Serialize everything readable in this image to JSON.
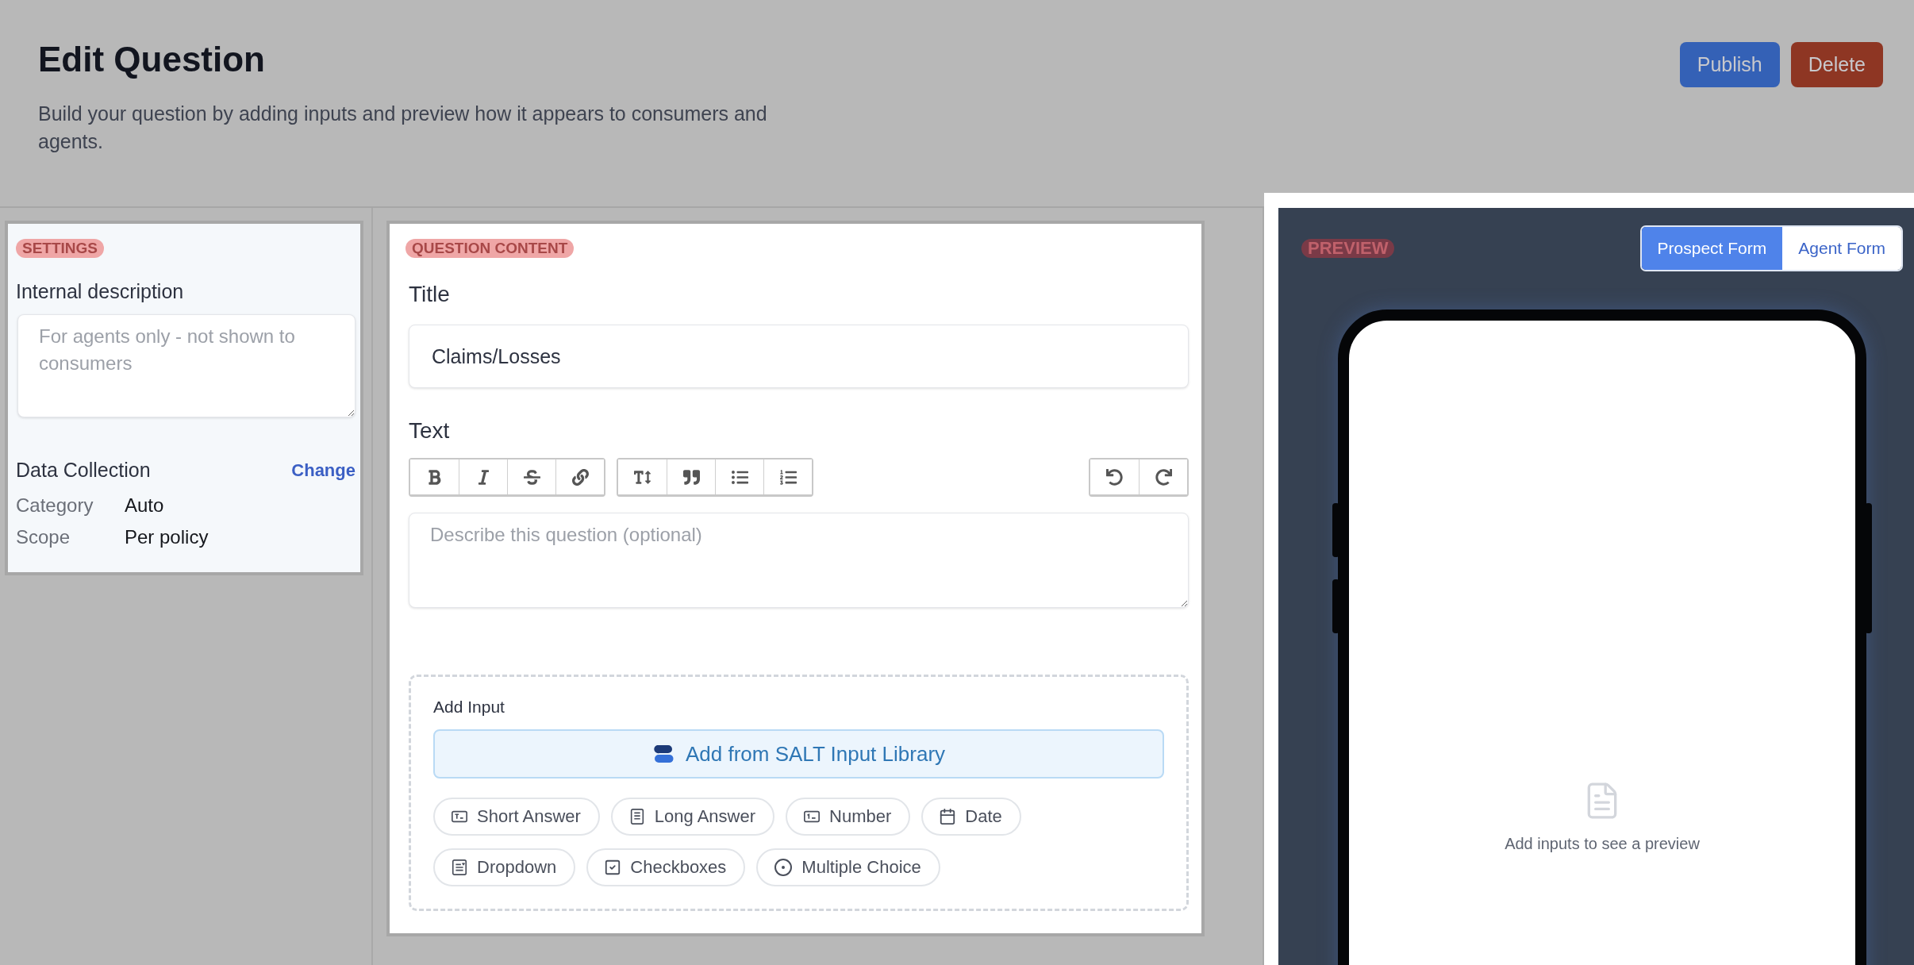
{
  "header": {
    "title": "Edit Question",
    "subtitle": "Build your question by adding inputs and preview how it appears to consumers and agents.",
    "actions": [
      {
        "label": "Publish",
        "kind": "primary"
      },
      {
        "label": "Delete",
        "kind": "danger"
      }
    ]
  },
  "settings": {
    "section_label": "SETTINGS",
    "internal_description": {
      "label": "Internal description",
      "placeholder": "For agents only - not shown to consumers"
    },
    "data_collection": {
      "title": "Data Collection",
      "action": "Change",
      "fields": [
        {
          "label": "Category",
          "value": "Auto"
        },
        {
          "label": "Scope",
          "value": "Per policy"
        }
      ]
    }
  },
  "question_content": {
    "section_label": "QUESTION CONTENT",
    "title_field": {
      "label": "Title",
      "value": "Claims/Losses"
    },
    "text_field": {
      "label": "Text",
      "placeholder": "Describe this question (optional)"
    },
    "add_input": {
      "label": "Add Input",
      "library_button": "Add from SALT Input Library",
      "input_types": [
        {
          "label": "Short Answer",
          "kind": "short"
        },
        {
          "label": "Long Answer",
          "kind": "long"
        },
        {
          "label": "Number",
          "kind": "number"
        },
        {
          "label": "Date",
          "kind": "date"
        },
        {
          "label": "Dropdown",
          "kind": "dropdown"
        },
        {
          "label": "Checkboxes",
          "kind": "checkboxes"
        },
        {
          "label": "Multiple Choice",
          "kind": "choice"
        }
      ]
    }
  },
  "preview": {
    "section_label": "PREVIEW",
    "tabs": [
      {
        "label": "Prospect Form",
        "selected": true
      },
      {
        "label": "Agent Form",
        "selected": false
      }
    ],
    "empty_message": "Add inputs to see a preview"
  }
}
